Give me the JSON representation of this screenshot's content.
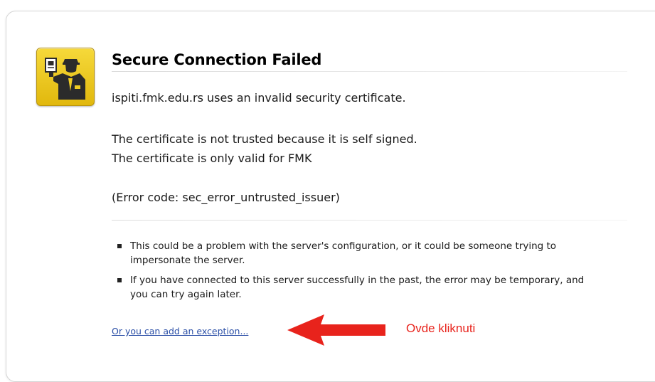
{
  "page": {
    "title": "Secure Connection Failed",
    "host_message": "ispiti.fmk.edu.rs uses an invalid security certificate.",
    "cert_line_1": "The certificate is not trusted because it is self signed.",
    "cert_line_2": "The certificate is only valid for FMK",
    "error_code": "(Error code: sec_error_untrusted_issuer)",
    "bullets": [
      "This could be a problem with the server's configuration, or it could be someone trying to impersonate the server.",
      "If you have connected to this server successfully in the past, the error may be temporary, and you can try again later."
    ],
    "exception_link": "Or you can add an exception...",
    "icon": "security-officer-icon"
  },
  "annotation": {
    "label": "Ovde kliknuti",
    "arrow_icon": "left-arrow-icon",
    "color": "#e8231c"
  },
  "colors": {
    "link": "#2a4ea6",
    "icon_yellow": "#f0cc22"
  }
}
